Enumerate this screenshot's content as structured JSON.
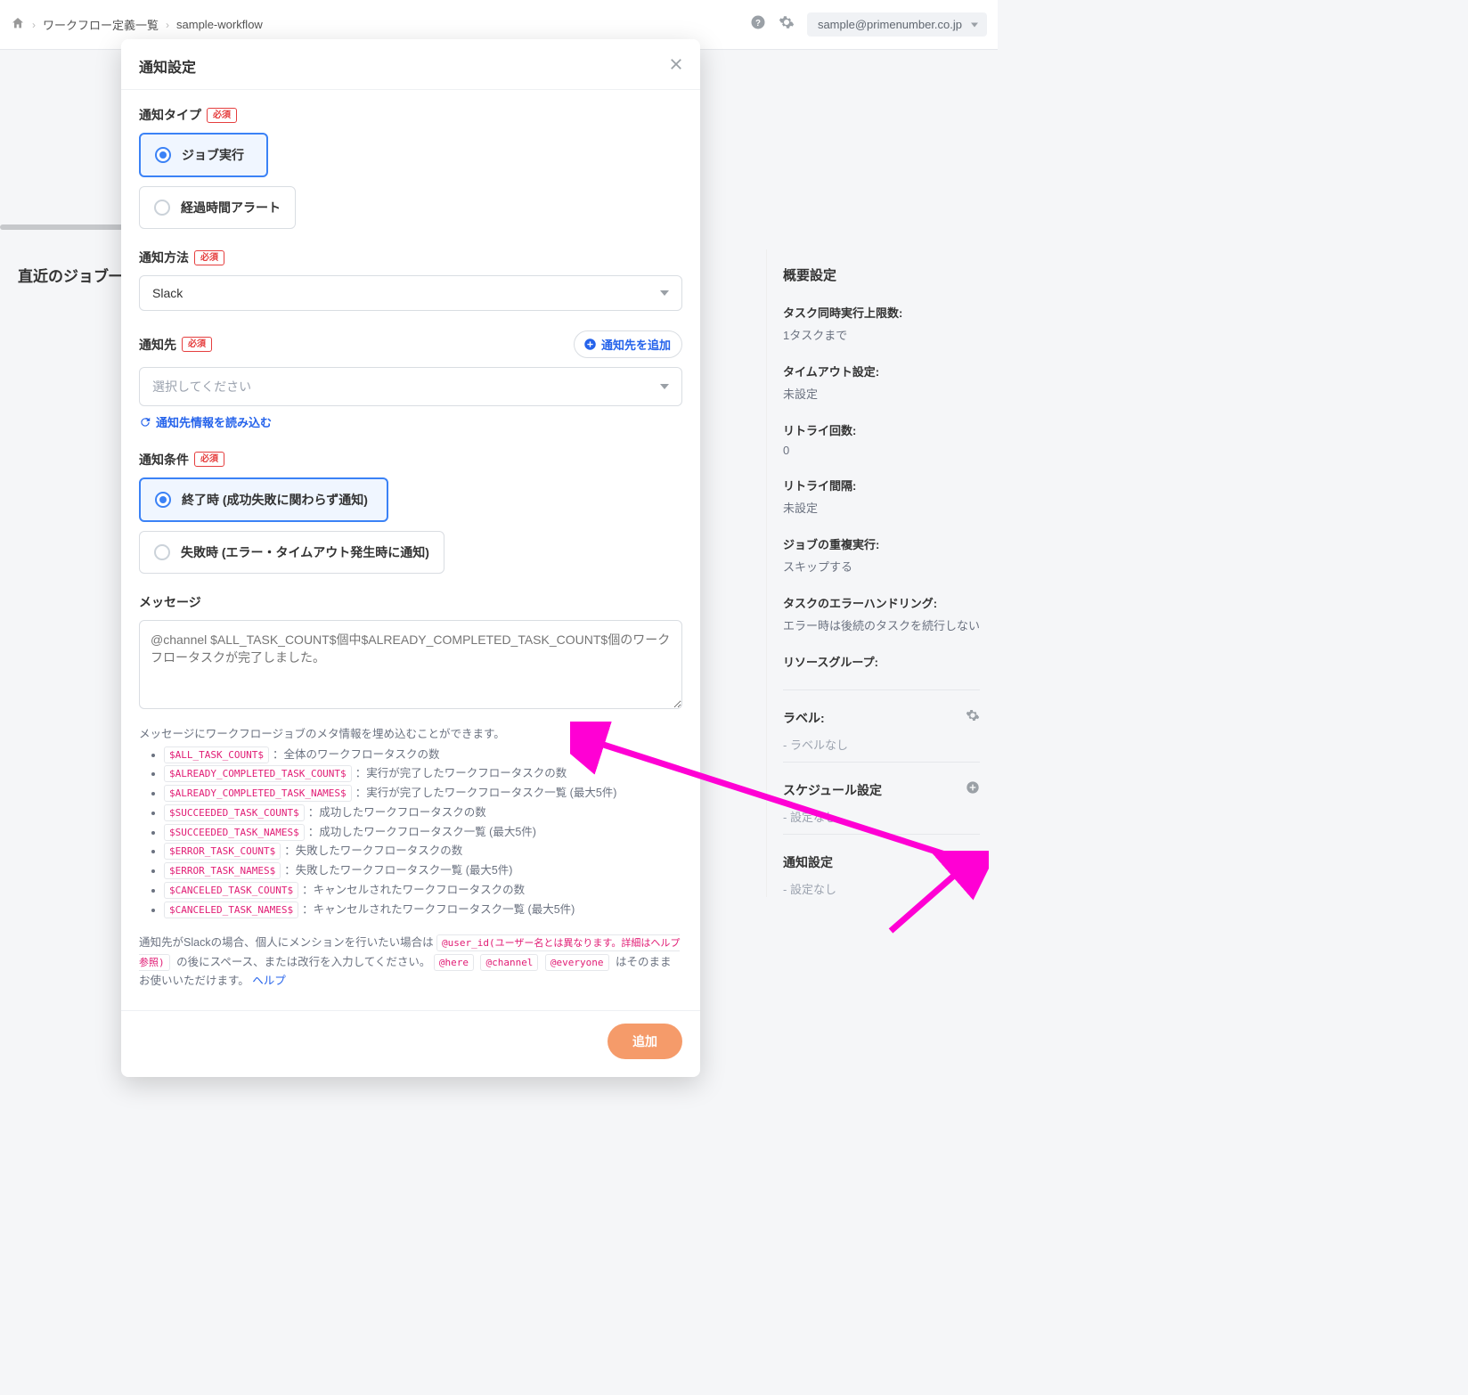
{
  "header": {
    "breadcrumbs": [
      {
        "label": "ワークフロー定義一覧"
      },
      {
        "label": "sample-workflow"
      }
    ],
    "user_email": "sample@primenumber.co.jp"
  },
  "page": {
    "recent_jobs_title": "直近のジョブ一覧"
  },
  "side_panel": {
    "overview_title": "概要設定",
    "items": [
      {
        "label": "タスク同時実行上限数:",
        "value": "1タスクまで"
      },
      {
        "label": "タイムアウト設定:",
        "value": "未設定"
      },
      {
        "label": "リトライ回数:",
        "value": "0"
      },
      {
        "label": "リトライ間隔:",
        "value": "未設定"
      },
      {
        "label": "ジョブの重複実行:",
        "value": "スキップする"
      },
      {
        "label": "タスクのエラーハンドリング:",
        "value": "エラー時は後続のタスクを続行しない"
      },
      {
        "label": "リソースグループ:",
        "value": ""
      }
    ],
    "label_section": {
      "title": "ラベル:",
      "placeholder": "- ラベルなし"
    },
    "schedule_section": {
      "title": "スケジュール設定",
      "placeholder": "- 設定なし"
    },
    "notify_section": {
      "title": "通知設定",
      "placeholder": "- 設定なし"
    }
  },
  "modal": {
    "title": "通知設定",
    "required_label": "必須",
    "type_label": "通知タイプ",
    "type_options": {
      "job": "ジョブ実行",
      "elapsed": "経過時間アラート"
    },
    "method_label": "通知方法",
    "method_value": "Slack",
    "dest_label": "通知先",
    "dest_placeholder": "選択してください",
    "add_dest_label": "通知先を追加",
    "reload_label": "通知先情報を読み込む",
    "condition_label": "通知条件",
    "condition_options": {
      "end": "終了時 (成功失敗に関わらず通知)",
      "fail": "失敗時 (エラー・タイムアウト発生時に通知)"
    },
    "message_label": "メッセージ",
    "message_placeholder": "@channel $ALL_TASK_COUNT$個中$ALREADY_COMPLETED_TASK_COUNT$個のワークフロータスクが完了しました。",
    "hint_intro": "メッセージにワークフロージョブのメタ情報を埋め込むことができます。",
    "variables": [
      {
        "code": "$ALL_TASK_COUNT$",
        "desc": "：全体のワークフロータスクの数"
      },
      {
        "code": "$ALREADY_COMPLETED_TASK_COUNT$",
        "desc": "：実行が完了したワークフロータスクの数"
      },
      {
        "code": "$ALREADY_COMPLETED_TASK_NAMES$",
        "desc": "：実行が完了したワークフロータスク一覧 (最大5件)"
      },
      {
        "code": "$SUCCEEDED_TASK_COUNT$",
        "desc": "：成功したワークフロータスクの数"
      },
      {
        "code": "$SUCCEEDED_TASK_NAMES$",
        "desc": "：成功したワークフロータスク一覧 (最大5件)"
      },
      {
        "code": "$ERROR_TASK_COUNT$",
        "desc": "：失敗したワークフロータスクの数"
      },
      {
        "code": "$ERROR_TASK_NAMES$",
        "desc": "：失敗したワークフロータスク一覧 (最大5件)"
      },
      {
        "code": "$CANCELED_TASK_COUNT$",
        "desc": "：キャンセルされたワークフロータスクの数"
      },
      {
        "code": "$CANCELED_TASK_NAMES$",
        "desc": "：キャンセルされたワークフロータスク一覧 (最大5件)"
      }
    ],
    "mention_note_1": "通知先がSlackの場合、個人にメンションを行いたい場合は ",
    "mention_user_code": "@user_id(ユーザー名とは異なります。詳細はヘルプ参照)",
    "mention_note_2": " の後にスペース、または改行を入力してください。 ",
    "mention_codes": [
      "@here",
      "@channel",
      "@everyone"
    ],
    "mention_note_3": " はそのままお使いいただけます。",
    "help_link": "ヘルプ",
    "submit_label": "追加"
  }
}
